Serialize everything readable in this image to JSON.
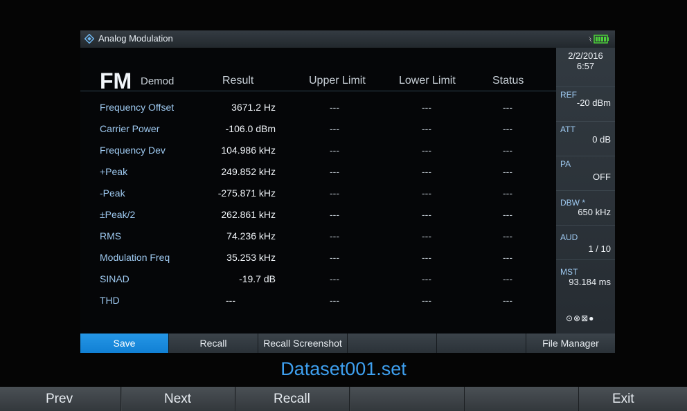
{
  "title": "Analog Modulation",
  "header": {
    "fm": "FM",
    "demod": "Demod",
    "col_result": "Result",
    "col_upper": "Upper Limit",
    "col_lower": "Lower Limit",
    "col_status": "Status"
  },
  "rows": [
    {
      "name": "Frequency Offset",
      "value": "3671.2 Hz",
      "upper": "---",
      "lower": "---",
      "status": "---"
    },
    {
      "name": "Carrier Power",
      "value": "-106.0 dBm",
      "upper": "---",
      "lower": "---",
      "status": "---"
    },
    {
      "name": "Frequency Dev",
      "value": "104.986 kHz",
      "upper": "---",
      "lower": "---",
      "status": "---"
    },
    {
      "name": "+Peak",
      "value": "249.852 kHz",
      "upper": "---",
      "lower": "---",
      "status": "---"
    },
    {
      "name": "-Peak",
      "value": "-275.871 kHz",
      "upper": "---",
      "lower": "---",
      "status": "---"
    },
    {
      "name": "±Peak/2",
      "value": "262.861 kHz",
      "upper": "---",
      "lower": "---",
      "status": "---"
    },
    {
      "name": "RMS",
      "value": "74.236 kHz",
      "upper": "---",
      "lower": "---",
      "status": "---"
    },
    {
      "name": "Modulation Freq",
      "value": "35.253 kHz",
      "upper": "---",
      "lower": "---",
      "status": "---"
    },
    {
      "name": "SINAD",
      "value": "-19.7 dB",
      "upper": "---",
      "lower": "---",
      "status": "---"
    },
    {
      "name": "THD",
      "value": "---",
      "upper": "---",
      "lower": "---",
      "status": "---"
    }
  ],
  "side": {
    "date": "2/2/2016",
    "time": "6:57",
    "ref_label": "REF",
    "ref_value": "-20 dBm",
    "att_label": "ATT",
    "att_value": "0 dB",
    "pa_label": "PA",
    "pa_value": "OFF",
    "dbw_label": "DBW *",
    "dbw_value": "650 kHz",
    "aud_label": "AUD",
    "aud_value": "1 / 10",
    "mst_label": "MST",
    "mst_value": "93.184 ms",
    "status_icons": "⊙⊗⊠●"
  },
  "softkeys": [
    "Save",
    "Recall",
    "Recall Screenshot",
    "",
    "",
    "File Manager"
  ],
  "filename": "Dataset001.set",
  "funckeys": [
    "Prev",
    "Next",
    "Recall",
    "",
    "",
    "Exit"
  ],
  "colors": {
    "accent": "#1a8ae0",
    "filename": "#3ea0f0",
    "battery": "#4cd13a"
  }
}
